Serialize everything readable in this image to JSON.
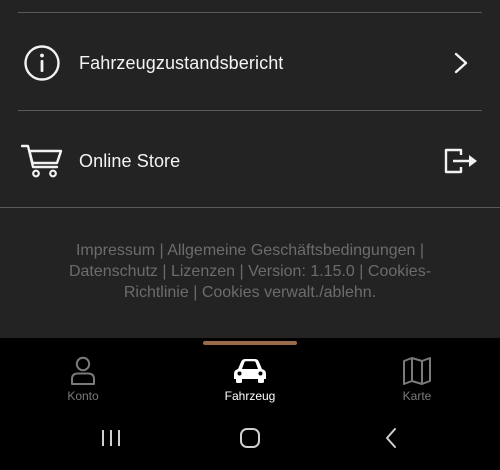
{
  "menu": {
    "items": [
      {
        "label": "Fahrzeugzustandsbericht",
        "icon": "info-circle-icon",
        "action_icon": "chevron-right-icon"
      },
      {
        "label": "Online Store",
        "icon": "shopping-cart-icon",
        "action_icon": "external-link-exit-icon"
      }
    ]
  },
  "footer": {
    "impressum": "Impressum",
    "agb": "Allgemeine Geschäftsbedingungen",
    "datenschutz": "Datenschutz",
    "lizenzen": "Lizenzen",
    "version": "Version: 1.15.0",
    "cookies_policy": "Cookies-Richtlinie",
    "cookies_manage": "Cookies verwalt./ablehn.",
    "separator": "|"
  },
  "bottom_nav": {
    "active_index": 1,
    "items": [
      {
        "label": "Konto",
        "icon": "person-icon"
      },
      {
        "label": "Fahrzeug",
        "icon": "car-icon"
      },
      {
        "label": "Karte",
        "icon": "map-icon"
      }
    ]
  },
  "system_nav": {
    "buttons": [
      "recent-apps-icon",
      "home-icon",
      "back-icon"
    ]
  },
  "colors": {
    "background": "#232323",
    "bottom_bar": "#000000",
    "active_indicator": "#9a6a48",
    "footer_text": "#6c6c6c",
    "inactive_nav": "#7a7a7a",
    "active_nav": "#ffffff"
  }
}
